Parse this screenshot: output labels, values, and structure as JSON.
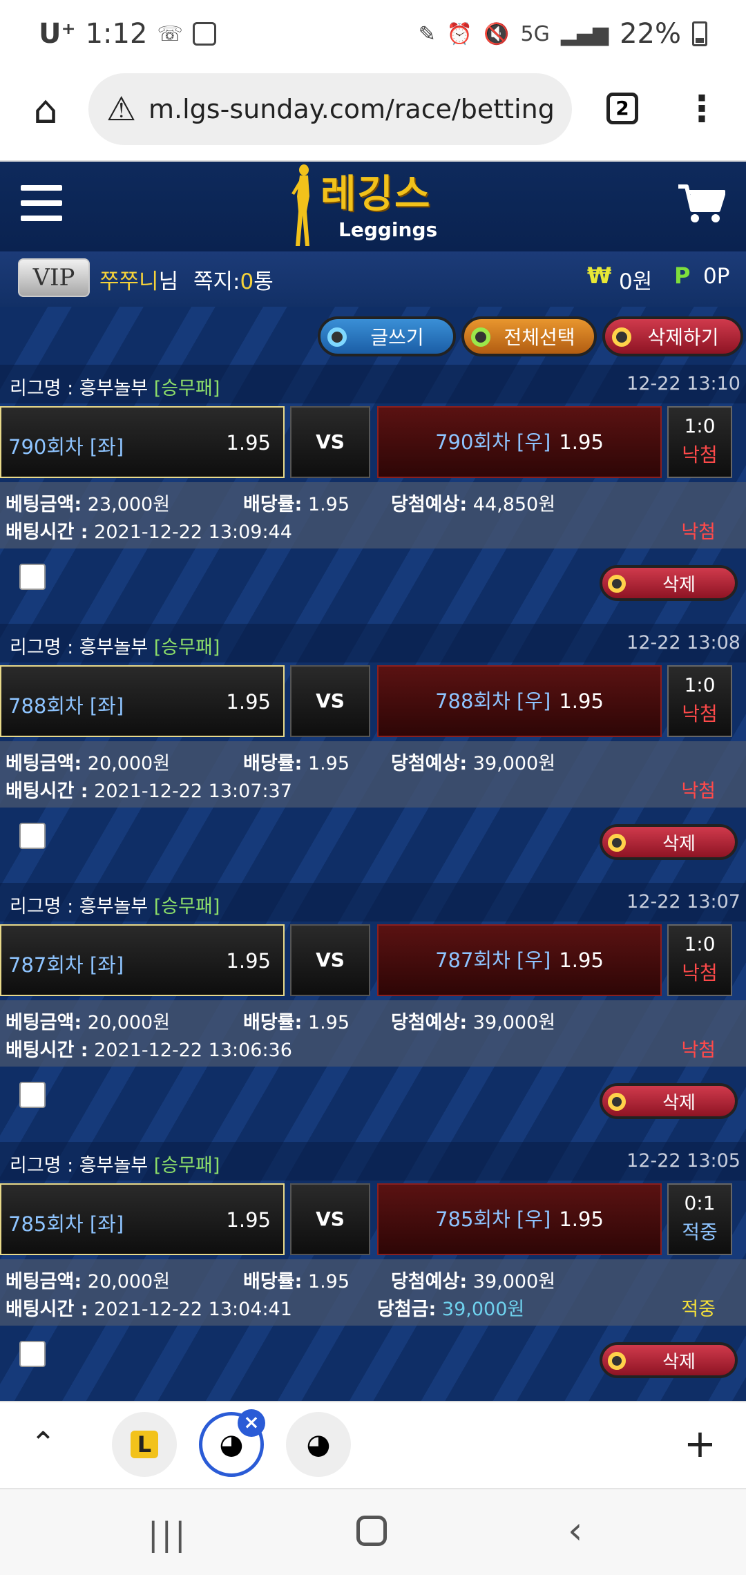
{
  "status_bar": {
    "carrier": "U⁺",
    "time": "1:12",
    "network": "5G",
    "battery": "22%"
  },
  "browser": {
    "url": "m.lgs-sunday.com/race/betting",
    "tab_count": "2"
  },
  "site": {
    "logo_ko": "레깅스",
    "logo_en": "Leggings"
  },
  "user": {
    "vip": "VIP",
    "nickname": "쭈쭈니",
    "suffix": "님",
    "msg_label": "쪽지:",
    "msg_count": "0",
    "msg_unit": "통",
    "won_symbol": "₩",
    "won": "0원",
    "point_symbol": "P",
    "points": "0P"
  },
  "actions": {
    "write": "글쓰기",
    "select_all": "전체선택",
    "delete_selected": "삭제하기"
  },
  "labels": {
    "league_prefix": "리그명 : ",
    "amount": "베팅금액:",
    "rate": "배당률:",
    "expected": "당첨예상:",
    "time": "배팅시간 :",
    "win_amount": "당첨금:",
    "vs": "VS",
    "delete": "삭제"
  },
  "bets": [
    {
      "league": "흥부놀부",
      "type": "[승무패]",
      "timestamp": "12-22 13:10",
      "home": "790회차 [좌]",
      "home_odds": "1.95",
      "away": "790회차 [우]",
      "away_odds": "1.95",
      "score": "1:0",
      "result": "낙첨",
      "amount": "23,000원",
      "rate": "1.95",
      "expected": "44,850원",
      "bet_time": "2021-12-22 13:09:44",
      "win_amount": "",
      "status": "낙첨"
    },
    {
      "league": "흥부놀부",
      "type": "[승무패]",
      "timestamp": "12-22 13:08",
      "home": "788회차 [좌]",
      "home_odds": "1.95",
      "away": "788회차 [우]",
      "away_odds": "1.95",
      "score": "1:0",
      "result": "낙첨",
      "amount": "20,000원",
      "rate": "1.95",
      "expected": "39,000원",
      "bet_time": "2021-12-22 13:07:37",
      "win_amount": "",
      "status": "낙첨"
    },
    {
      "league": "흥부놀부",
      "type": "[승무패]",
      "timestamp": "12-22 13:07",
      "home": "787회차 [좌]",
      "home_odds": "1.95",
      "away": "787회차 [우]",
      "away_odds": "1.95",
      "score": "1:0",
      "result": "낙첨",
      "amount": "20,000원",
      "rate": "1.95",
      "expected": "39,000원",
      "bet_time": "2021-12-22 13:06:36",
      "win_amount": "",
      "status": "낙첨"
    },
    {
      "league": "흥부놀부",
      "type": "[승무패]",
      "timestamp": "12-22 13:05",
      "home": "785회차 [좌]",
      "home_odds": "1.95",
      "away": "785회차 [우]",
      "away_odds": "1.95",
      "score": "0:1",
      "result": "적중",
      "amount": "20,000원",
      "rate": "1.95",
      "expected": "39,000원",
      "bet_time": "2021-12-22 13:04:41",
      "win_amount": "39,000원",
      "status": "적중"
    }
  ],
  "colors": {
    "lose": "#ff4a4a",
    "win_result": "#8ec4ff",
    "win_status": "#f5e03a"
  }
}
